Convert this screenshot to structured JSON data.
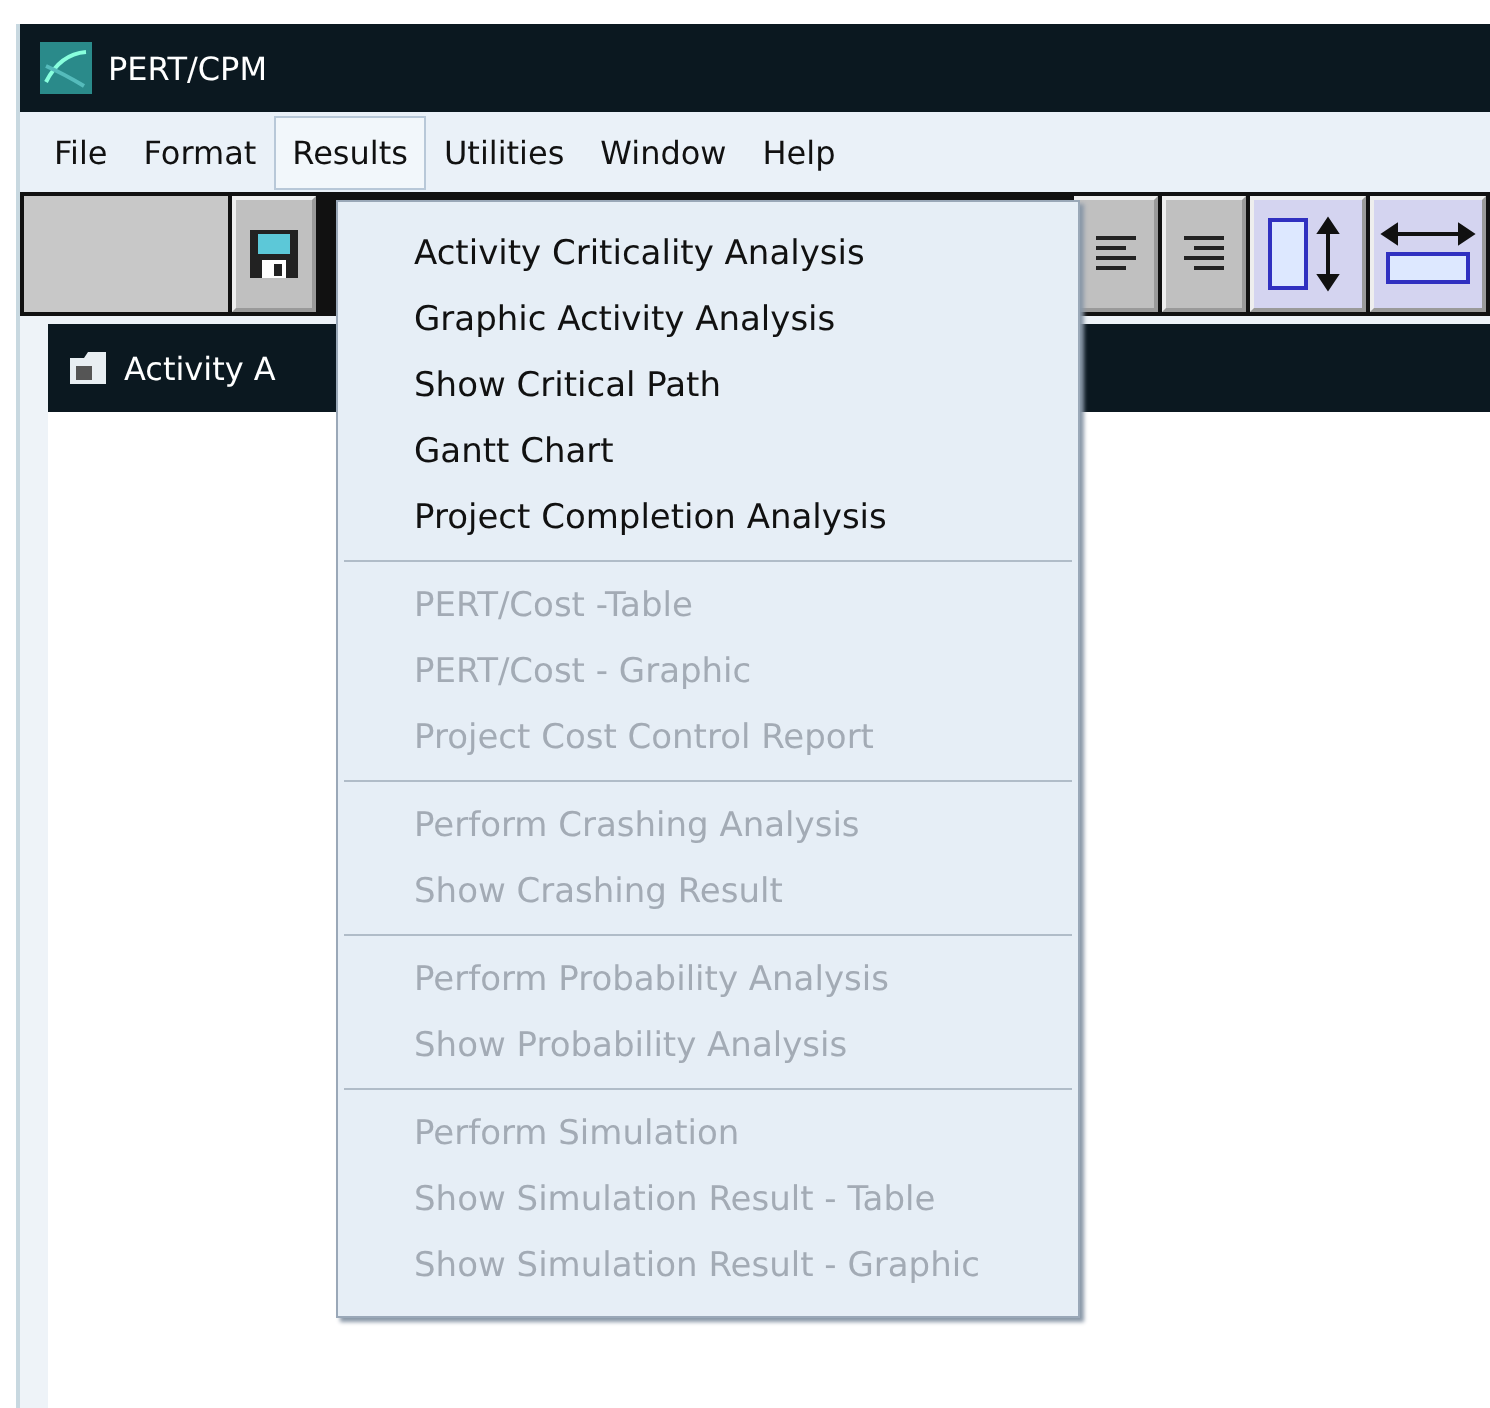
{
  "window": {
    "title": "PERT/CPM"
  },
  "menu_bar": [
    {
      "label": "File",
      "selected": false
    },
    {
      "label": "Format",
      "selected": false
    },
    {
      "label": "Results",
      "selected": true
    },
    {
      "label": "Utilities",
      "selected": false
    },
    {
      "label": "Window",
      "selected": false
    },
    {
      "label": "Help",
      "selected": false
    }
  ],
  "child_window": {
    "title": "Activity A"
  },
  "dropdown": {
    "groups": [
      [
        {
          "label": "Activity Criticality Analysis",
          "disabled": false
        },
        {
          "label": "Graphic Activity Analysis",
          "disabled": false
        },
        {
          "label": "Show Critical Path",
          "disabled": false
        },
        {
          "label": "Gantt Chart",
          "disabled": false
        },
        {
          "label": "Project Completion Analysis",
          "disabled": false
        }
      ],
      [
        {
          "label": "PERT/Cost -Table",
          "disabled": true
        },
        {
          "label": "PERT/Cost - Graphic",
          "disabled": true
        },
        {
          "label": "Project Cost Control Report",
          "disabled": true
        }
      ],
      [
        {
          "label": "Perform Crashing Analysis",
          "disabled": true
        },
        {
          "label": "Show Crashing Result",
          "disabled": true
        }
      ],
      [
        {
          "label": "Perform Probability Analysis",
          "disabled": true
        },
        {
          "label": "Show Probability Analysis",
          "disabled": true
        }
      ],
      [
        {
          "label": "Perform Simulation",
          "disabled": true
        },
        {
          "label": "Show Simulation Result - Table",
          "disabled": true
        },
        {
          "label": "Show Simulation Result - Graphic",
          "disabled": true
        }
      ]
    ]
  }
}
